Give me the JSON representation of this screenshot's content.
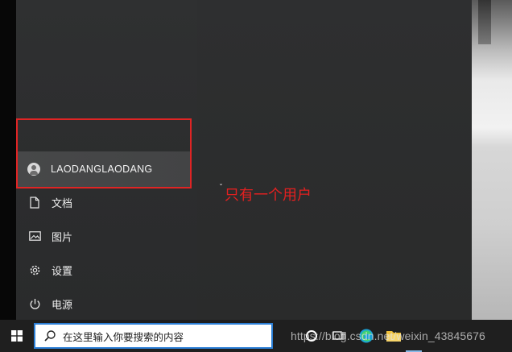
{
  "user": {
    "name": "LAODANGLAODANG"
  },
  "menu_items": [
    {
      "label": "文档",
      "icon": "document-icon"
    },
    {
      "label": "图片",
      "icon": "pictures-icon"
    },
    {
      "label": "设置",
      "icon": "gear-icon"
    },
    {
      "label": "电源",
      "icon": "power-icon"
    }
  ],
  "annotation": {
    "text": "只有一个用户",
    "color": "#e32020"
  },
  "taskbar": {
    "search_placeholder": "在这里输入你要搜索的内容",
    "icons": [
      "windows-logo-icon",
      "search-icon",
      "cortana-icon",
      "task-view-icon",
      "edge-icon",
      "file-explorer-icon"
    ]
  },
  "watermark": "https://blog.csdn.net/weixin_43845676",
  "colors": {
    "highlight_box": "#e02424",
    "search_border": "#2c7fd6",
    "taskbar": "#1f1f1f"
  }
}
